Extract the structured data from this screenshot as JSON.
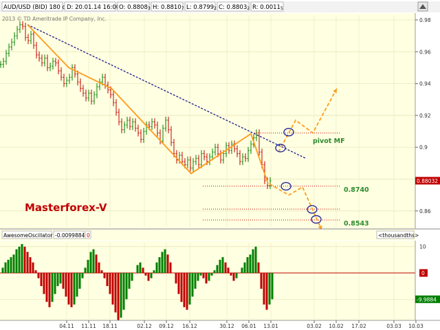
{
  "header": {
    "symbol": "AUD/USD (BID) 180 d 4h",
    "date": "D: 20.01.14 16:00",
    "open": "O: 0.8808",
    "open_suffix": "3",
    "high": "H: 0.8810",
    "high_suffix": "7",
    "low": "L: 0.8799",
    "low_suffix": "2",
    "close": "C: 0.8803",
    "close_suffix": "2",
    "range": "R: 0.0011",
    "range_suffix": "5"
  },
  "copyright": "2013 © TD Ameritrade IP Company, Inc.",
  "watermark": "Masterforex-V",
  "colors": {
    "chart_bg": "#ffffe1",
    "up_bar": "#008000",
    "down_bar": "#c00000",
    "fib_orange": "#ff9a1a",
    "trend_blue": "#1a1a8c",
    "level_red": "#cc0000",
    "circle_blue": "#2b2b99",
    "label_green": "#2e8b2e"
  },
  "level_labels": {
    "pivot": "pivot MF",
    "l8740": "0.8740",
    "l8543": "0.8543"
  },
  "oscillator": {
    "name": "AwesomeOscillator",
    "value": "-0.0099884",
    "extra": "0",
    "units": "<thousandths>",
    "current_badge": "-9.9884",
    "zero_badge": "0",
    "ticks": [
      "10",
      "-10"
    ]
  },
  "chart_data": {
    "type": "line",
    "price": {
      "x": [
        0,
        4,
        8,
        12,
        16,
        20,
        24,
        28,
        32,
        36,
        40,
        44,
        48,
        52,
        56,
        60,
        64,
        68,
        72,
        76,
        80,
        84,
        88,
        92,
        96,
        100,
        104,
        108,
        112,
        116,
        120,
        124,
        128,
        132,
        136,
        140,
        144,
        148,
        152,
        156,
        160,
        164,
        168,
        172,
        176,
        180,
        184,
        188,
        192,
        196,
        200,
        204,
        208,
        212,
        216,
        220,
        224,
        228,
        232,
        236,
        240,
        244,
        248,
        252,
        256,
        260,
        264,
        268,
        272,
        276,
        280,
        284,
        288,
        292,
        296,
        300,
        304,
        308,
        312,
        316,
        320,
        324,
        328,
        332,
        336,
        340,
        344,
        348,
        352,
        356,
        360,
        364,
        368,
        372,
        376,
        380,
        384,
        388,
        392
      ],
      "y": [
        0.952,
        0.954,
        0.959,
        0.963,
        0.966,
        0.97,
        0.974,
        0.977,
        0.976,
        0.969,
        0.967,
        0.971,
        0.964,
        0.958,
        0.956,
        0.953,
        0.956,
        0.95,
        0.951,
        0.954,
        0.953,
        0.948,
        0.944,
        0.94,
        0.942,
        0.944,
        0.95,
        0.946,
        0.941,
        0.937,
        0.934,
        0.931,
        0.934,
        0.929,
        0.933,
        0.938,
        0.941,
        0.944,
        0.939,
        0.936,
        0.933,
        0.928,
        0.922,
        0.916,
        0.911,
        0.914,
        0.917,
        0.913,
        0.916,
        0.912,
        0.909,
        0.905,
        0.91,
        0.914,
        0.913,
        0.916,
        0.914,
        0.909,
        0.904,
        0.912,
        0.917,
        0.911,
        0.903,
        0.896,
        0.892,
        0.895,
        0.891,
        0.889,
        0.892,
        0.887,
        0.891,
        0.893,
        0.889,
        0.896,
        0.894,
        0.891,
        0.894,
        0.897,
        0.9,
        0.896,
        0.892,
        0.896,
        0.901,
        0.898,
        0.902,
        0.899,
        0.896,
        0.891,
        0.894,
        0.893,
        0.898,
        0.902,
        0.906,
        0.909,
        0.897,
        0.889,
        0.879,
        0.876,
        0.879
      ]
    },
    "zigzag": {
      "name": "",
      "x": [
        40,
        100,
        162,
        278,
        365,
        390
      ],
      "y": [
        0.977,
        0.95,
        0.937,
        0.8835,
        0.9085,
        0.877
      ]
    },
    "projection": {
      "x": [
        390,
        394,
        400,
        406,
        412,
        420,
        426,
        432,
        438,
        444,
        450,
        456,
        462,
        470
      ],
      "y": [
        0.876,
        0.878,
        0.879,
        0.882,
        0.885,
        0.89,
        0.895,
        0.9,
        0.905,
        0.909,
        0.914,
        0.919,
        0.923,
        0.866
      ]
    },
    "trendline": {
      "x": [
        40,
        445
      ],
      "y": [
        0.977,
        0.893
      ]
    },
    "levels": [
      {
        "y": 0.909,
        "x_start": 370,
        "x_end": 495
      },
      {
        "y": 0.8756,
        "x_start": 295,
        "x_end": 495
      },
      {
        "y": 0.8612,
        "x_start": 295,
        "x_end": 495
      },
      {
        "y": 0.8543,
        "x_start": 295,
        "x_end": 495
      }
    ],
    "circles": [
      {
        "x": 420,
        "y": 0.9095
      },
      {
        "x": 408,
        "y": 0.8995
      },
      {
        "x": 416,
        "y": 0.8755
      },
      {
        "x": 454,
        "y": 0.861
      },
      {
        "x": 460,
        "y": 0.8547
      }
    ],
    "arrows": [
      {
        "path_x": [
          405,
          430,
          455,
          490
        ],
        "path_y": [
          0.897,
          0.917,
          0.909,
          0.937
        ]
      },
      {
        "path_x": [
          392,
          420,
          440,
          468
        ],
        "path_y": [
          0.877,
          0.87,
          0.875,
          0.848
        ]
      }
    ],
    "y_ticks": [
      0.98,
      0.96,
      0.94,
      0.92,
      0.9,
      0.88,
      0.86
    ],
    "ylim": [
      0.85,
      0.983
    ],
    "x_tick_labels": [
      "04.11",
      "11.11",
      "18.11",
      "02.12",
      "09.12",
      "16.12",
      "30.12",
      "06.01",
      "13.01",
      "03.02",
      "10.02",
      "17.02",
      "03.03",
      "10.03"
    ],
    "x_tick_positions": [
      97,
      129,
      160,
      210,
      242,
      276,
      330,
      362,
      394,
      457,
      489,
      522,
      573,
      605
    ],
    "current_price_badge": "0.88032",
    "oscillator_values": [
      2,
      4,
      5,
      6,
      7,
      9,
      10,
      11,
      10,
      8,
      6,
      4,
      1,
      -2,
      -5,
      -8,
      -11,
      -13,
      -11,
      -8,
      -5,
      -4,
      -6,
      -9,
      -12,
      -13,
      -12,
      -9,
      -6,
      -2,
      2,
      5,
      8,
      9,
      7,
      4,
      1,
      -2,
      -5,
      -8,
      -12,
      -15,
      -18,
      -17,
      -14,
      -10,
      -6,
      -3,
      0,
      3,
      4,
      2,
      -1,
      -3,
      -2,
      1,
      4,
      6,
      8,
      9,
      7,
      4,
      0,
      -4,
      -8,
      -11,
      -13,
      -14,
      -12,
      -9,
      -6,
      -3,
      -1,
      -2,
      -4,
      -3,
      -1,
      1,
      3,
      5,
      6,
      4,
      2,
      -1,
      -3,
      -2,
      0,
      2,
      4,
      6,
      7,
      9,
      10,
      4,
      -6,
      -12,
      -14,
      -12,
      -10
    ],
    "osc_ylim": [
      -17.5,
      11.5
    ]
  }
}
